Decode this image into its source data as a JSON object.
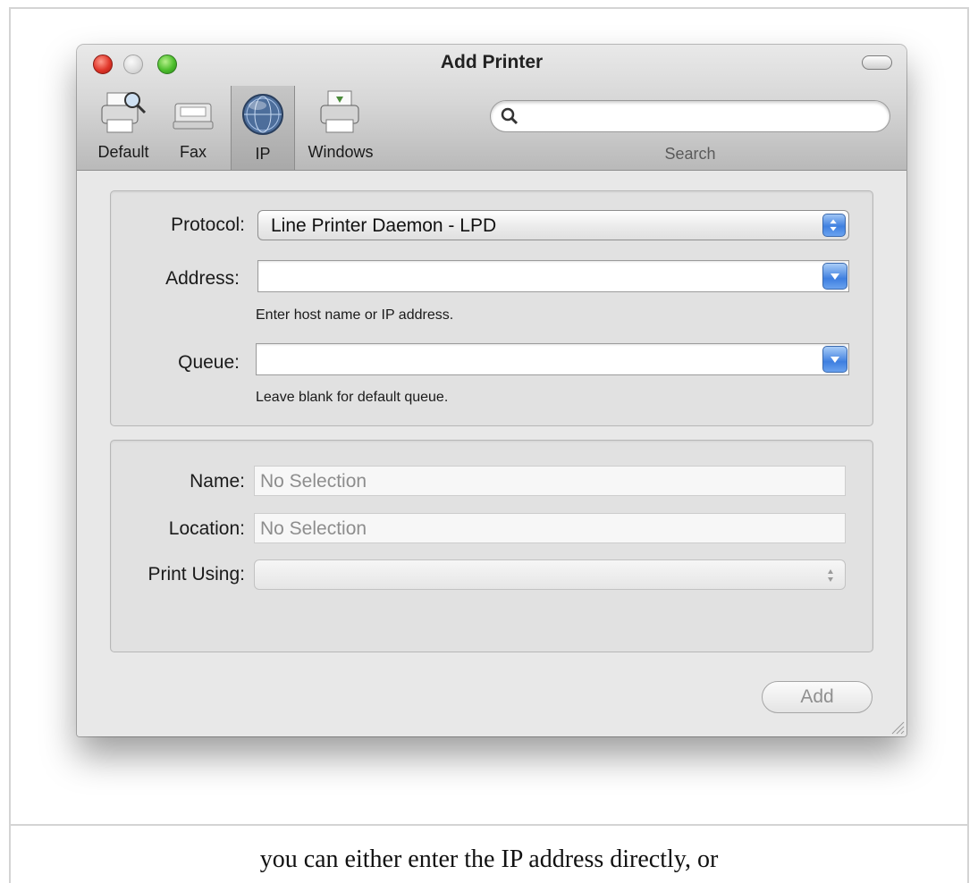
{
  "window": {
    "title": "Add Printer"
  },
  "toolbar": {
    "items": [
      {
        "label": "Default",
        "icon": "printer-search-icon"
      },
      {
        "label": "Fax",
        "icon": "fax-icon"
      },
      {
        "label": "IP",
        "icon": "globe-icon",
        "selected": true
      },
      {
        "label": "Windows",
        "icon": "windows-printer-icon"
      }
    ],
    "search": {
      "label": "Search",
      "value": ""
    }
  },
  "connection": {
    "protocol_label": "Protocol:",
    "protocol_value": "Line Printer Daemon - LPD",
    "address_label": "Address:",
    "address_value": "",
    "address_hint": "Enter host name or IP address.",
    "queue_label": "Queue:",
    "queue_value": "",
    "queue_hint": "Leave blank for default queue."
  },
  "printer_info": {
    "name_label": "Name:",
    "name_value": "No Selection",
    "location_label": "Location:",
    "location_value": "No Selection",
    "print_using_label": "Print Using:",
    "print_using_value": ""
  },
  "actions": {
    "add_label": "Add"
  },
  "caption": "you can either enter the IP address directly, or",
  "colors": {
    "close": "#e0362a",
    "zoom": "#4cbe2c",
    "stepper": "#3f80e0"
  }
}
